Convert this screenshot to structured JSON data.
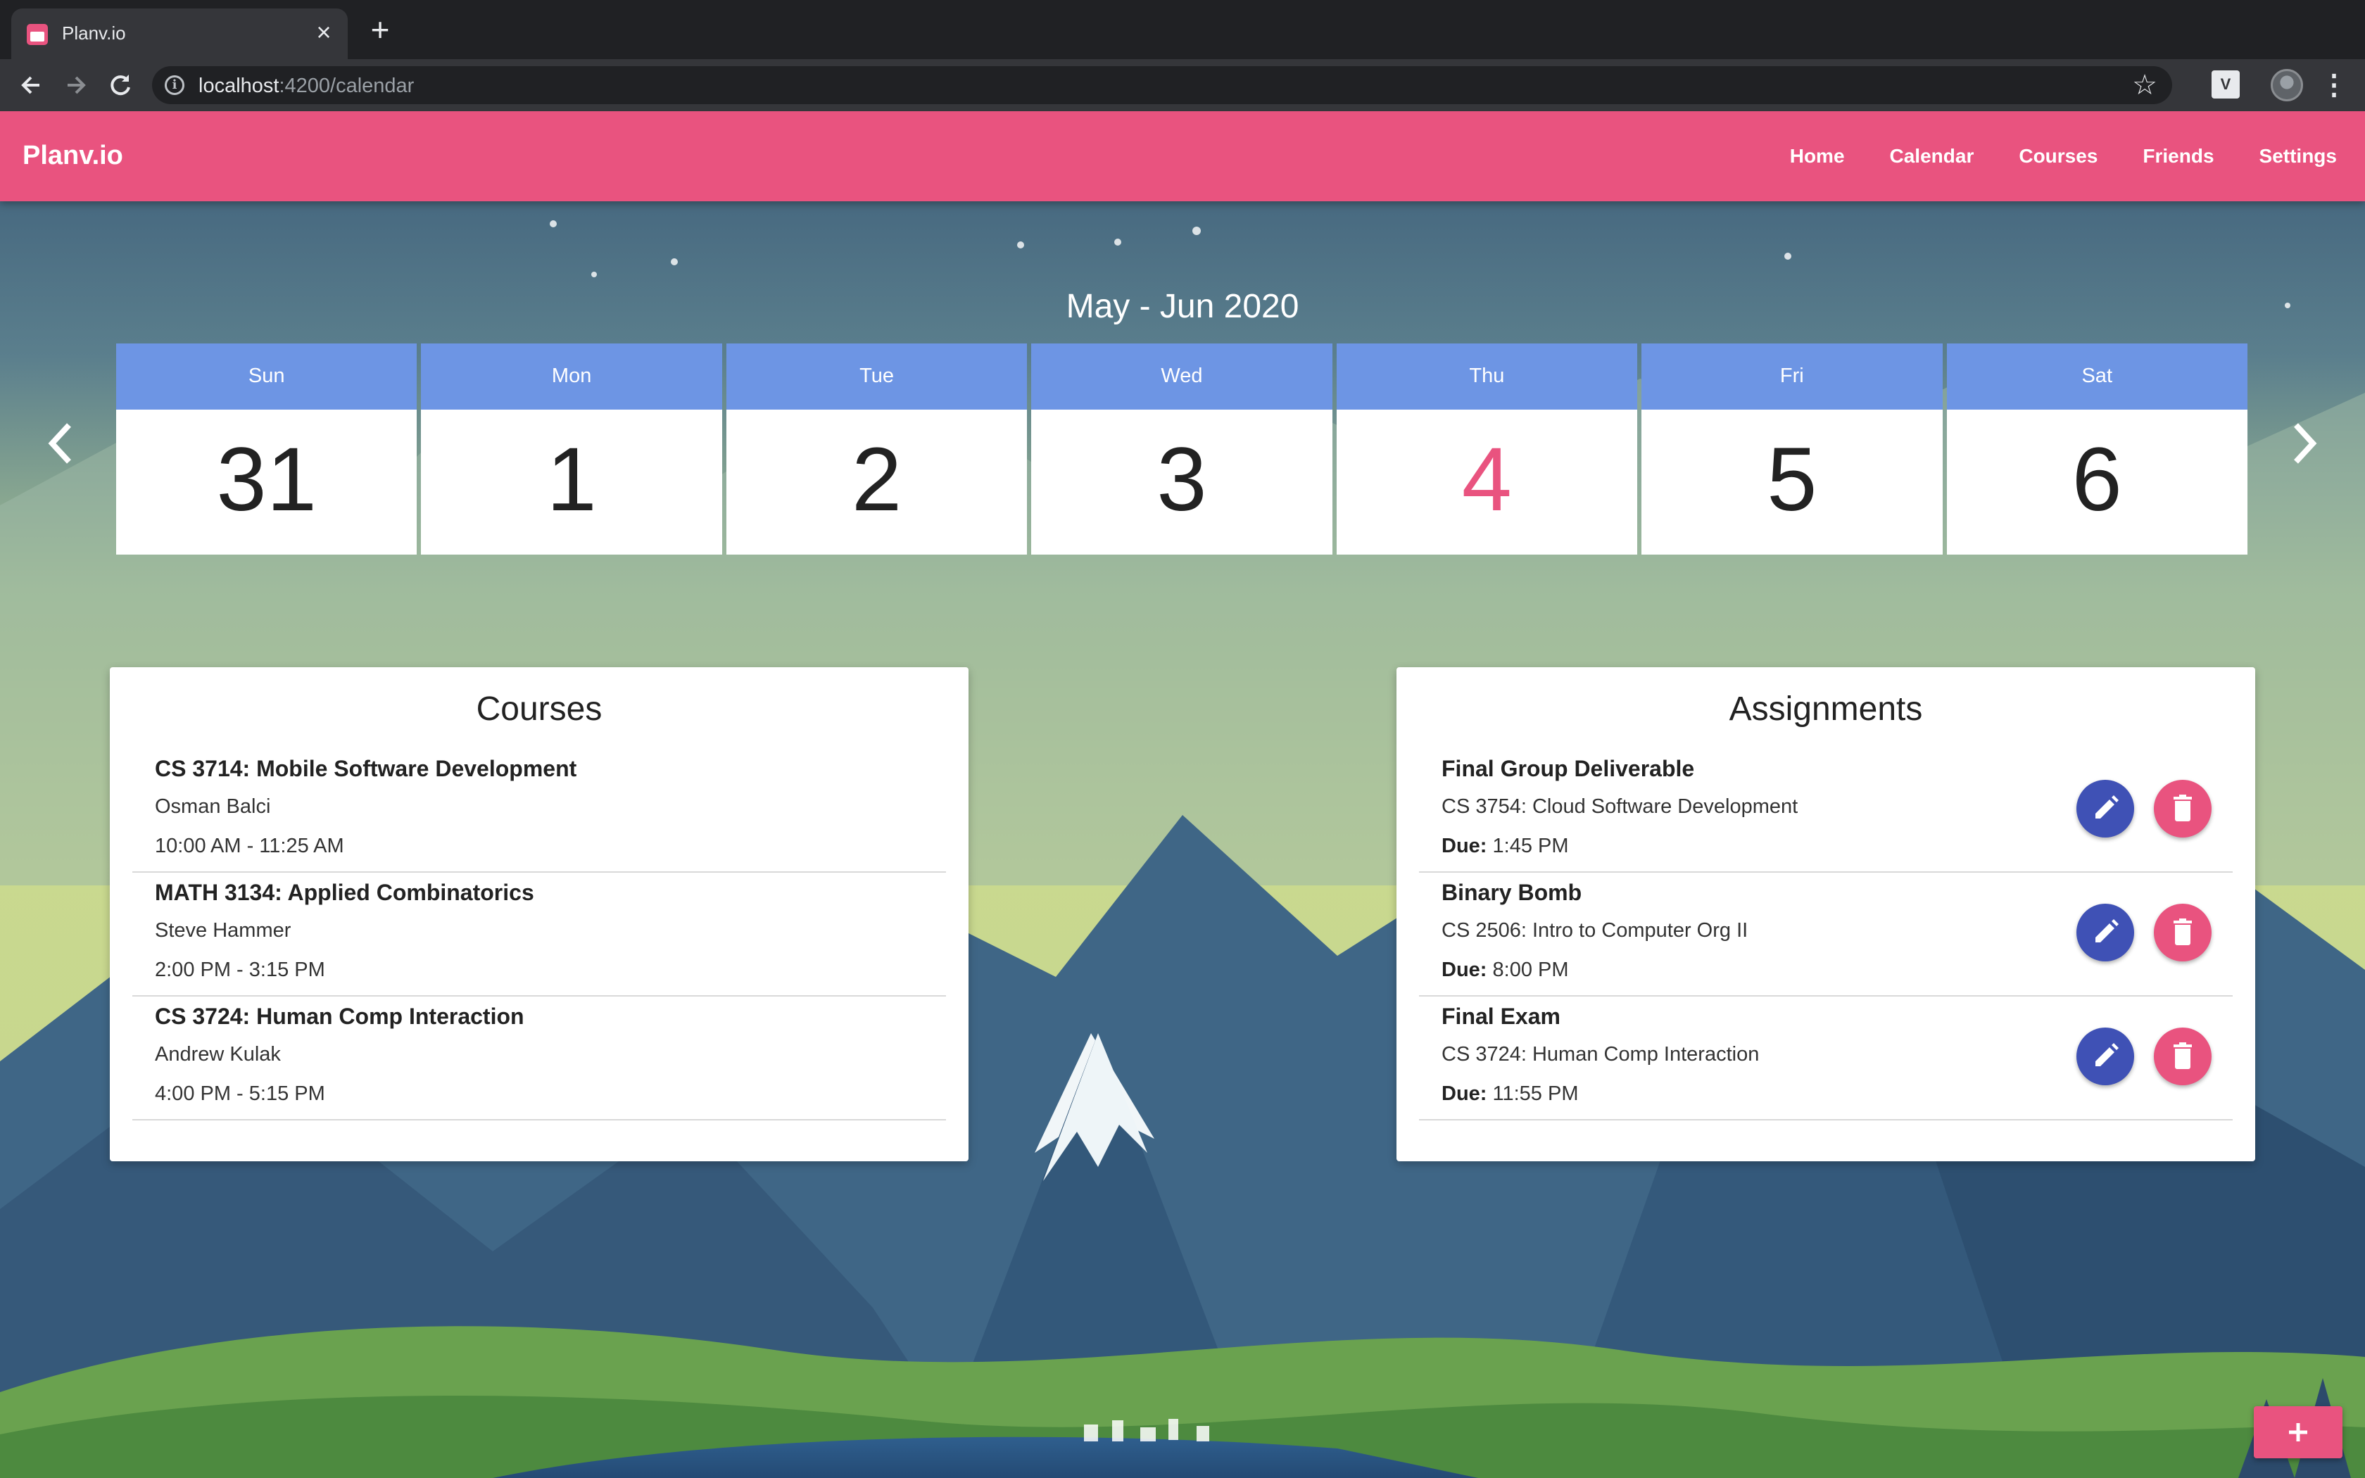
{
  "browser": {
    "tab_title": "Planv.io",
    "url_host": "localhost",
    "url_path": ":4200/calendar"
  },
  "nav": {
    "brand": "Planv.io",
    "links": [
      "Home",
      "Calendar",
      "Courses",
      "Friends",
      "Settings"
    ]
  },
  "calendar": {
    "month_label": "May - Jun 2020",
    "days": [
      {
        "name": "Sun",
        "date": "31"
      },
      {
        "name": "Mon",
        "date": "1"
      },
      {
        "name": "Tue",
        "date": "2"
      },
      {
        "name": "Wed",
        "date": "3"
      },
      {
        "name": "Thu",
        "date": "4"
      },
      {
        "name": "Fri",
        "date": "5"
      },
      {
        "name": "Sat",
        "date": "6"
      }
    ],
    "today_index": 4
  },
  "courses": {
    "title": "Courses",
    "items": [
      {
        "name": "CS 3714: Mobile Software Development",
        "instructor": "Osman Balci",
        "time": "10:00 AM - 11:25 AM"
      },
      {
        "name": "MATH 3134: Applied Combinatorics",
        "instructor": "Steve Hammer",
        "time": "2:00 PM - 3:15 PM"
      },
      {
        "name": "CS 3724: Human Comp Interaction",
        "instructor": "Andrew Kulak",
        "time": "4:00 PM - 5:15 PM"
      }
    ]
  },
  "assignments": {
    "title": "Assignments",
    "due_label": "Due:",
    "items": [
      {
        "name": "Final Group Deliverable",
        "course": "CS 3754: Cloud Software Development",
        "due": "1:45 PM"
      },
      {
        "name": "Binary Bomb",
        "course": "CS 2506: Intro to Computer Org II",
        "due": "8:00 PM"
      },
      {
        "name": "Final Exam",
        "course": "CS 3724: Human Comp Interaction",
        "due": "11:55 PM"
      }
    ]
  },
  "colors": {
    "accent": "#e9537f",
    "day_header": "#6d95e4",
    "edit_button": "#3f51b5"
  },
  "icons": {
    "edit": "pencil-icon",
    "delete": "trash-icon",
    "add": "plus-icon",
    "prev": "chevron-left-icon",
    "next": "chevron-right-icon"
  }
}
